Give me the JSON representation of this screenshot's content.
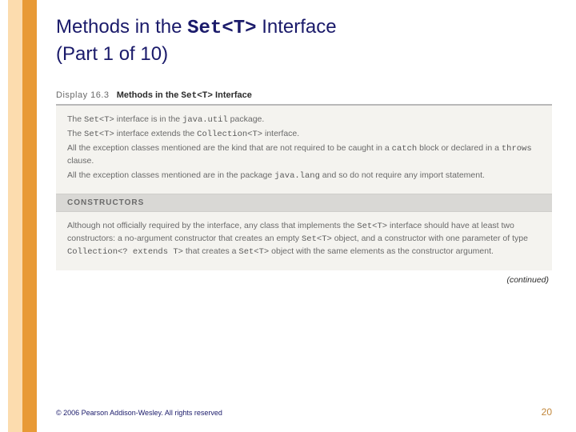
{
  "title": {
    "prefix": "Methods in the ",
    "code": "Set<T>",
    "suffix": " Interface",
    "line2": "(Part 1 of 10)"
  },
  "display": {
    "label": "Display 16.3",
    "heading_prefix": "Methods in the ",
    "heading_code": "Set<T>",
    "heading_suffix": " Interface"
  },
  "intro": {
    "l1a": "The ",
    "l1b": "Set<T>",
    "l1c": " interface is in the ",
    "l1d": "java.util",
    "l1e": " package.",
    "l2a": "The ",
    "l2b": "Set<T>",
    "l2c": " interface extends the ",
    "l2d": "Collection<T>",
    "l2e": " interface.",
    "l3a": "All the exception classes mentioned are the kind that are not required to be caught in a ",
    "l3b": "catch",
    "l3c": " block or declared in a ",
    "l3d": "throws",
    "l3e": " clause.",
    "l4a": "All the exception classes mentioned are in the package ",
    "l4b": "java.lang",
    "l4c": " and so do not require any import statement."
  },
  "section": {
    "constructors": "CONSTRUCTORS"
  },
  "constructors": {
    "a": "Although not officially required by the interface, any class that implements the ",
    "b": "Set<T>",
    "c": " interface should have at least two constructors: a no-argument constructor that creates an empty ",
    "d": "Set<T>",
    "e": " object, and a constructor with one parameter of type ",
    "f": "Collection<? extends T>",
    "g": " that creates a ",
    "h": "Set<T>",
    "i": " object with the same elements as the constructor argument."
  },
  "continued": "(continued)",
  "footer": {
    "copyright": "© 2006 Pearson Addison-Wesley. All rights reserved",
    "page": "20"
  }
}
